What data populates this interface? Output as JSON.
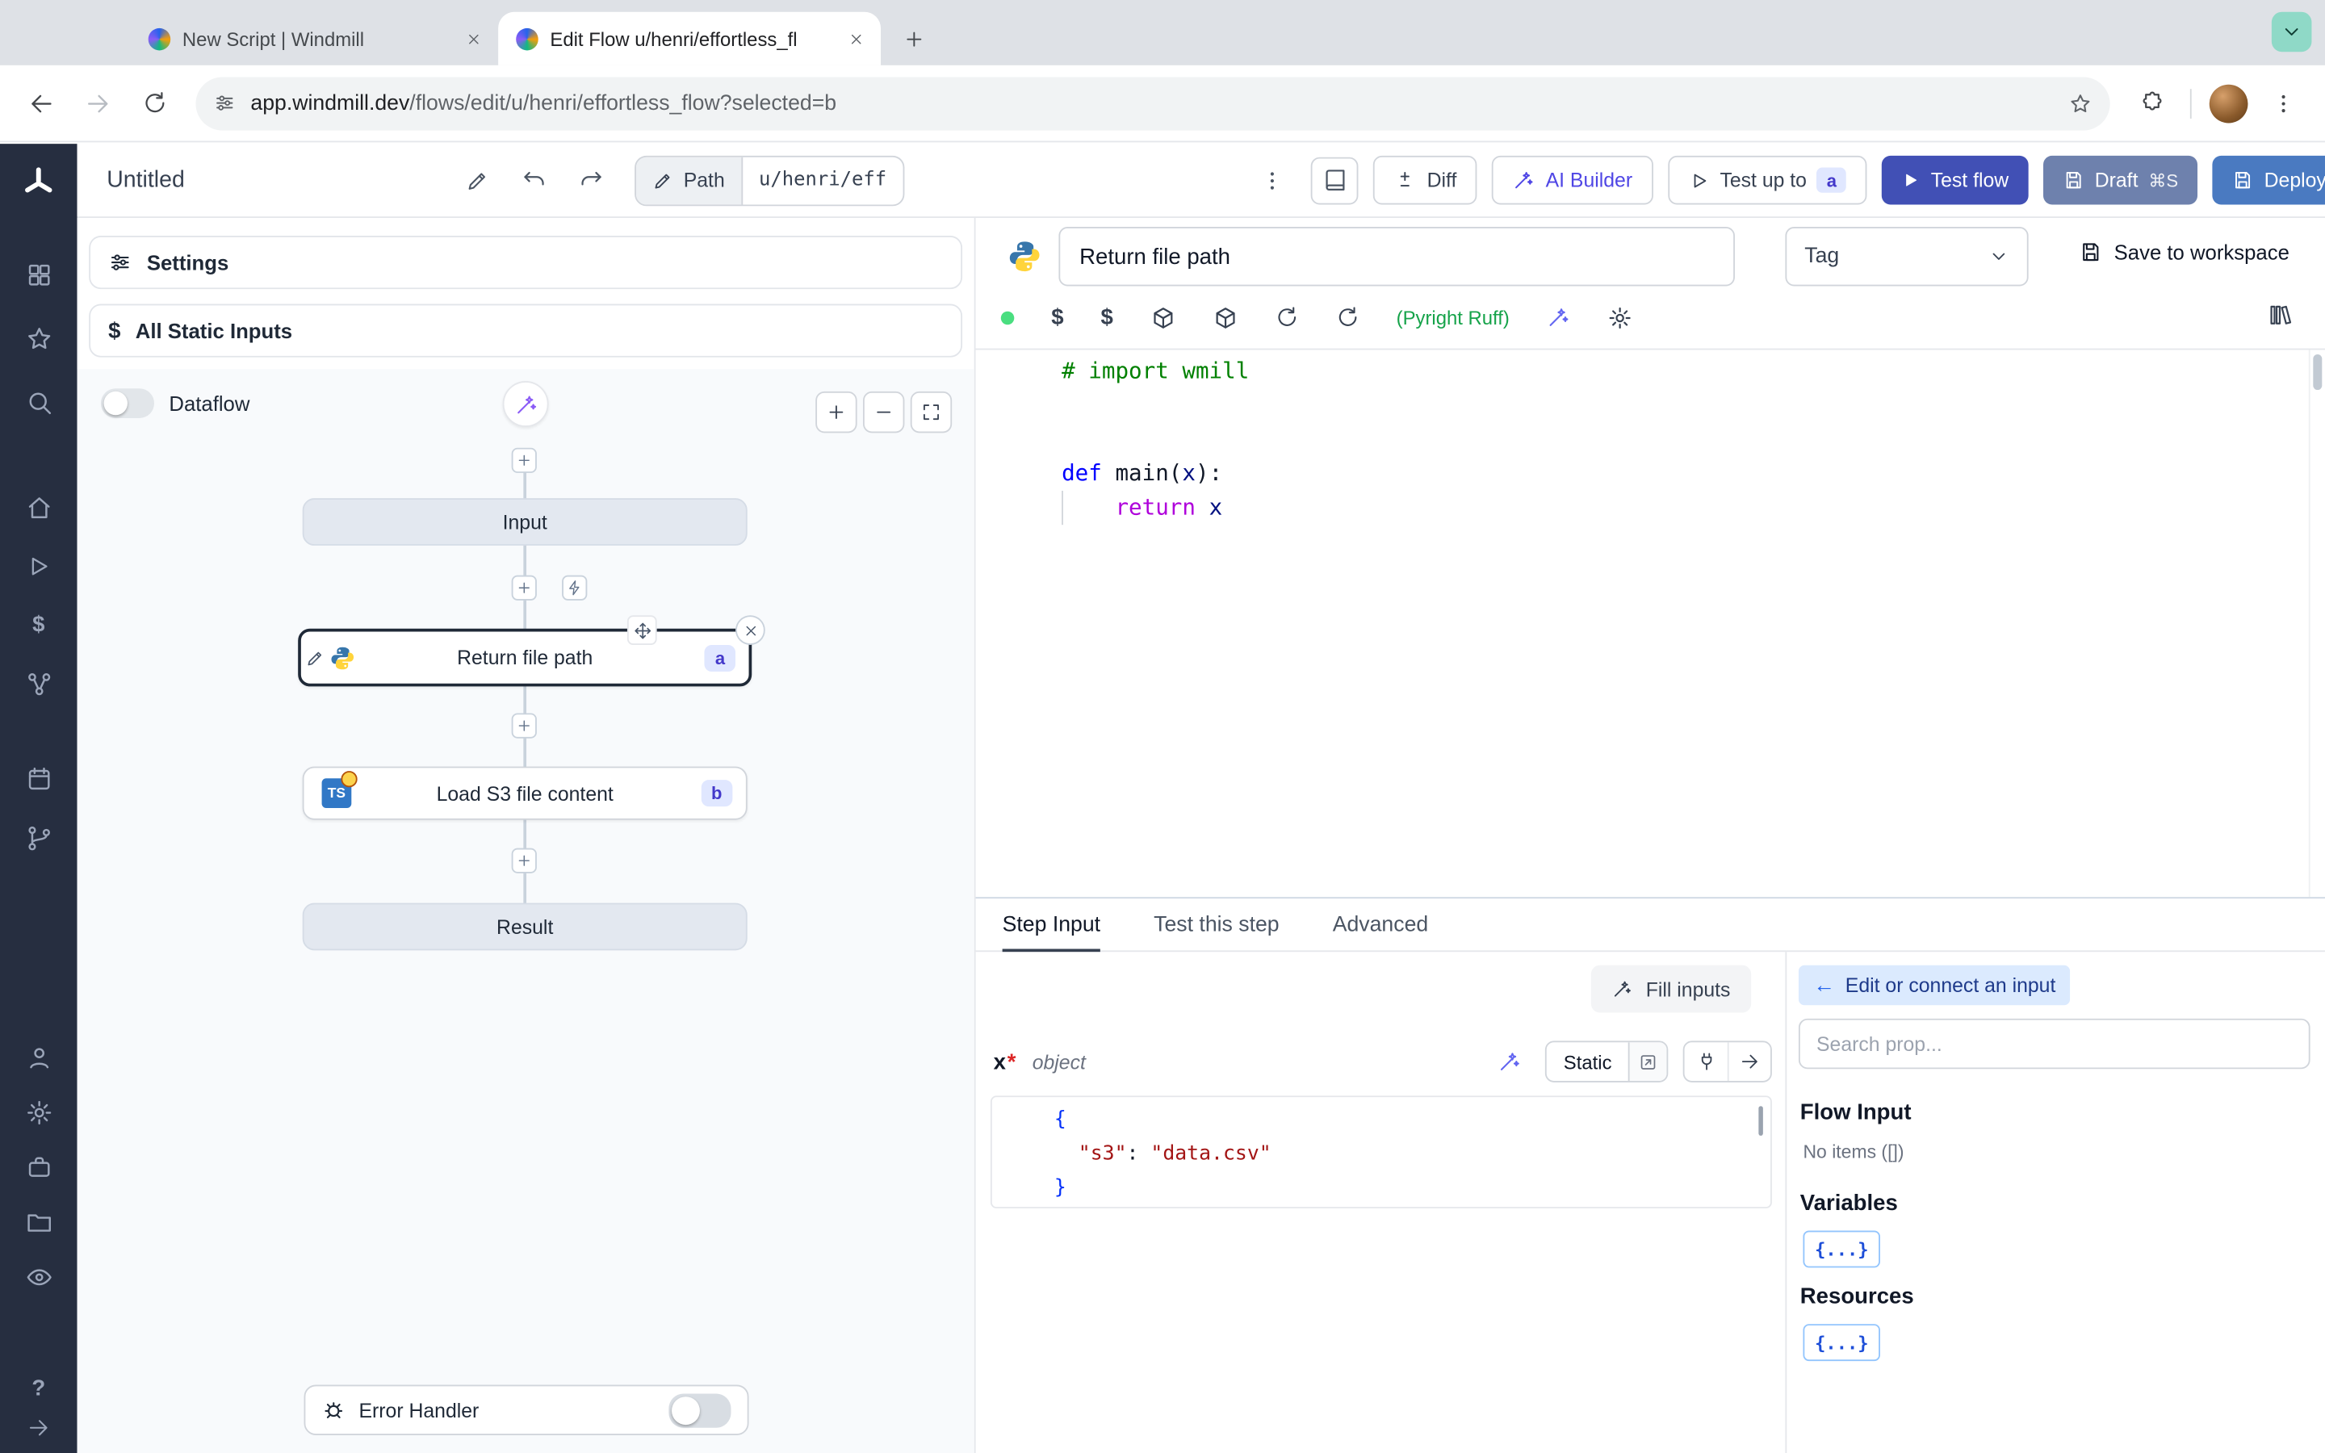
{
  "browser": {
    "tab_inactive": "New Script | Windmill",
    "tab_active": "Edit Flow u/henri/effortless_fl",
    "url_host": "app.windmill.dev",
    "url_path": "/flows/edit/u/henri/effortless_flow?selected=b"
  },
  "toolbar": {
    "title": "Untitled",
    "path_label": "Path",
    "path_value": "u/henri/eff",
    "diff_label": "Diff",
    "ai_builder_label": "AI Builder",
    "test_up_to_label": "Test up to",
    "test_up_to_badge": "a",
    "test_flow_label": "Test flow",
    "draft_label": "Draft",
    "draft_shortcut": "⌘S",
    "deploy_label": "Deploy"
  },
  "flow": {
    "settings_label": "Settings",
    "static_inputs_label": "All Static Inputs",
    "dataflow_label": "Dataflow",
    "input_node_label": "Input",
    "step_a_label": "Return file path",
    "step_a_badge": "a",
    "step_b_label": "Load S3 file content",
    "step_b_badge": "b",
    "step_b_icon_text": "TS",
    "result_node_label": "Result",
    "error_handler_label": "Error Handler"
  },
  "editor": {
    "step_name": "Return file path",
    "tag_label": "Tag",
    "save_label": "Save to workspace",
    "lint_label": "(Pyright Ruff)",
    "code_lines": [
      [
        {
          "t": "# import wmill",
          "c": "comment"
        }
      ],
      [],
      [],
      [
        {
          "t": "def",
          "c": "kw"
        },
        {
          "t": " ",
          "c": "plain"
        },
        {
          "t": "main",
          "c": "fn"
        },
        {
          "t": "(",
          "c": "plain"
        },
        {
          "t": "x",
          "c": "name"
        },
        {
          "t": "):",
          "c": "plain"
        }
      ],
      [
        {
          "t": "    ",
          "c": "plain"
        },
        {
          "t": "return",
          "c": "kw2"
        },
        {
          "t": " ",
          "c": "plain"
        },
        {
          "t": "x",
          "c": "name"
        }
      ]
    ]
  },
  "step_panel": {
    "tabs": [
      "Step Input",
      "Test this step",
      "Advanced"
    ],
    "fill_inputs_label": "Fill inputs",
    "prop_name": "x",
    "prop_required_mark": "*",
    "prop_type": "object",
    "static_label": "Static",
    "json_lines": [
      [
        {
          "t": "{",
          "c": "brace"
        }
      ],
      [
        {
          "t": "  ",
          "c": "plain"
        },
        {
          "t": "\"s3\"",
          "c": "key"
        },
        {
          "t": ": ",
          "c": "plain"
        },
        {
          "t": "\"data.csv\"",
          "c": "str"
        }
      ],
      [
        {
          "t": "}",
          "c": "brace"
        }
      ]
    ]
  },
  "connect": {
    "back_glyph": "←",
    "edit_connect_label": "Edit or connect an input",
    "search_placeholder": "Search prop...",
    "flow_input_title": "Flow Input",
    "flow_input_empty": "No items ([])",
    "variables_title": "Variables",
    "variables_button": "{...}",
    "resources_title": "Resources",
    "resources_button": "{...}"
  },
  "colors": {
    "test_flow_button": "#4150b5",
    "draft_button": "#6e81ad",
    "deploy_button": "#4a7ac1",
    "badge_bg": "#e0e7ff",
    "badge_text": "#4338ca",
    "ai_accent": "#4f46e5",
    "lint_green": "#16a34a",
    "tab_search_teal": "#8fd9c7",
    "sidebar_bg": "#262e40"
  }
}
